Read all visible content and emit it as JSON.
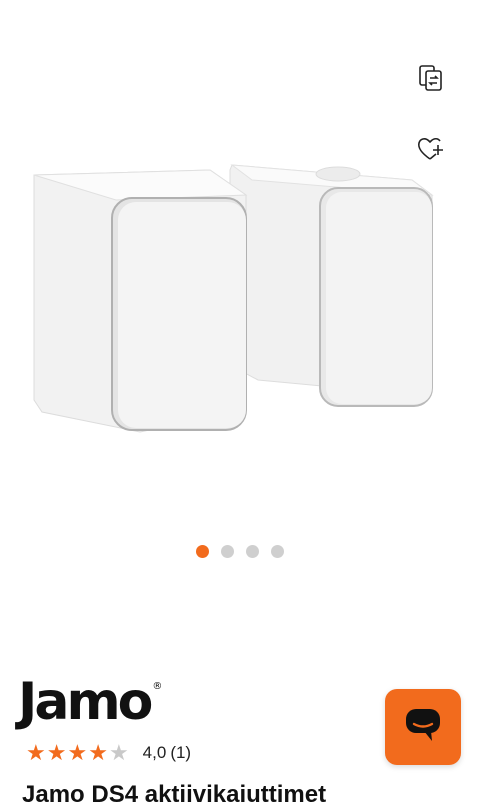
{
  "brand": {
    "name": "Jamo",
    "logo_text": "Jamo",
    "registered": "®"
  },
  "gallery": {
    "image_alt": "Jamo DS4 aktiivikaiuttimet, valkoinen",
    "dots_count": 4,
    "active_index": 0
  },
  "icons": {
    "compare": "compare-icon",
    "wishlist": "heart-plus-icon",
    "chat": "chat-bubble-icon"
  },
  "rating": {
    "value": 4.0,
    "max": 5,
    "value_label": "4,0",
    "count_label": "(1)"
  },
  "product": {
    "title": "Jamo DS4 aktiivikaiuttimet"
  },
  "colors": {
    "accent": "#f26b1d",
    "star_empty": "#c9c9c9",
    "dot_inactive": "#cfcfcf"
  }
}
